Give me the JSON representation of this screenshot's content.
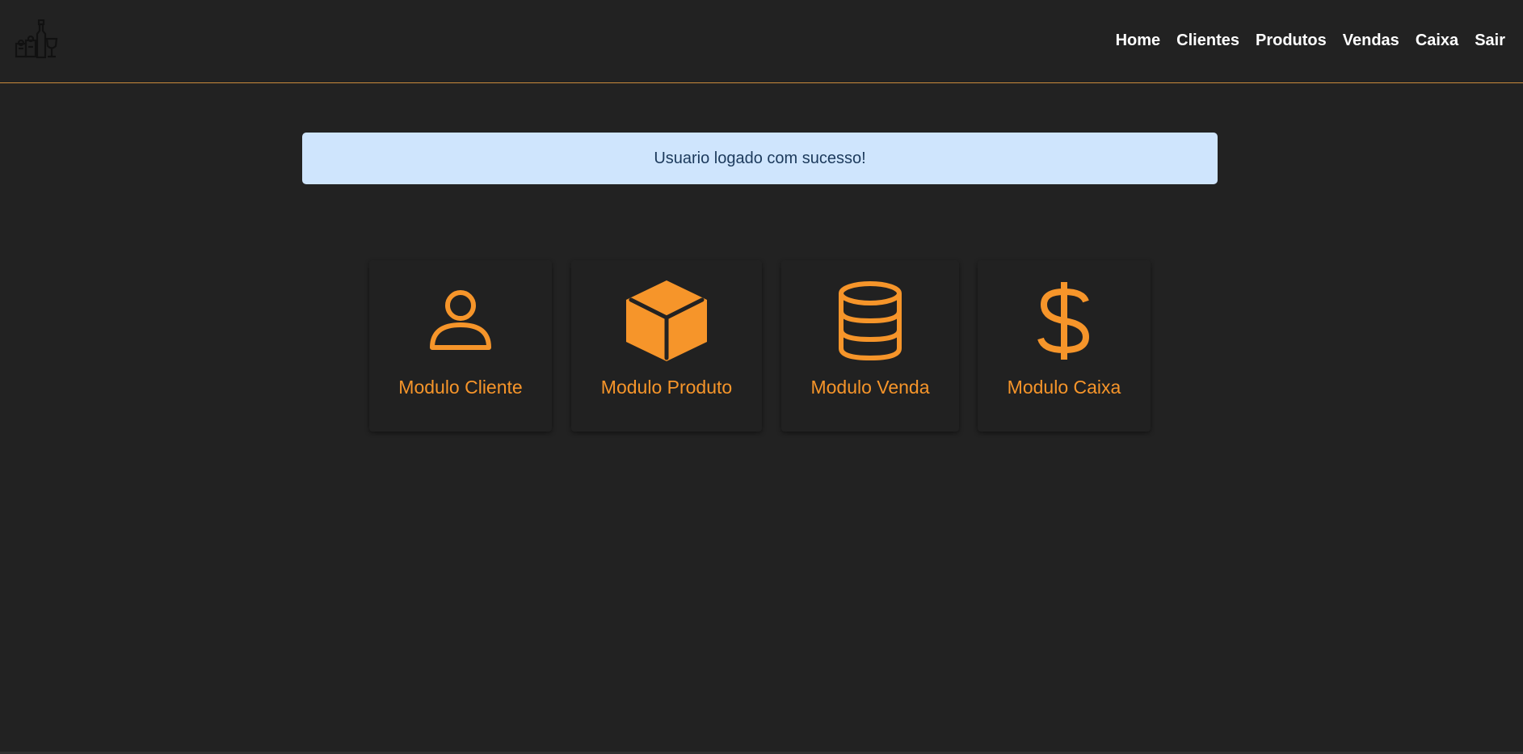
{
  "navbar": {
    "logo_icon": "drinks-shop-logo-icon",
    "links": [
      {
        "label": "Home"
      },
      {
        "label": "Clientes"
      },
      {
        "label": "Produtos"
      },
      {
        "label": "Vendas"
      },
      {
        "label": "Caixa"
      },
      {
        "label": "Sair"
      }
    ]
  },
  "alert": {
    "message": "Usuario logado com sucesso!"
  },
  "modules": [
    {
      "label": "Modulo Cliente",
      "icon": "person-icon"
    },
    {
      "label": "Modulo Produto",
      "icon": "box-icon"
    },
    {
      "label": "Modulo Venda",
      "icon": "database-icon"
    },
    {
      "label": "Modulo Caixa",
      "icon": "dollar-icon"
    }
  ],
  "colors": {
    "background": "#222222",
    "accent": "#f6952a",
    "navbar_border": "#c98a3c",
    "alert_background": "#cfe5fd",
    "alert_text": "#1c3a5c"
  }
}
